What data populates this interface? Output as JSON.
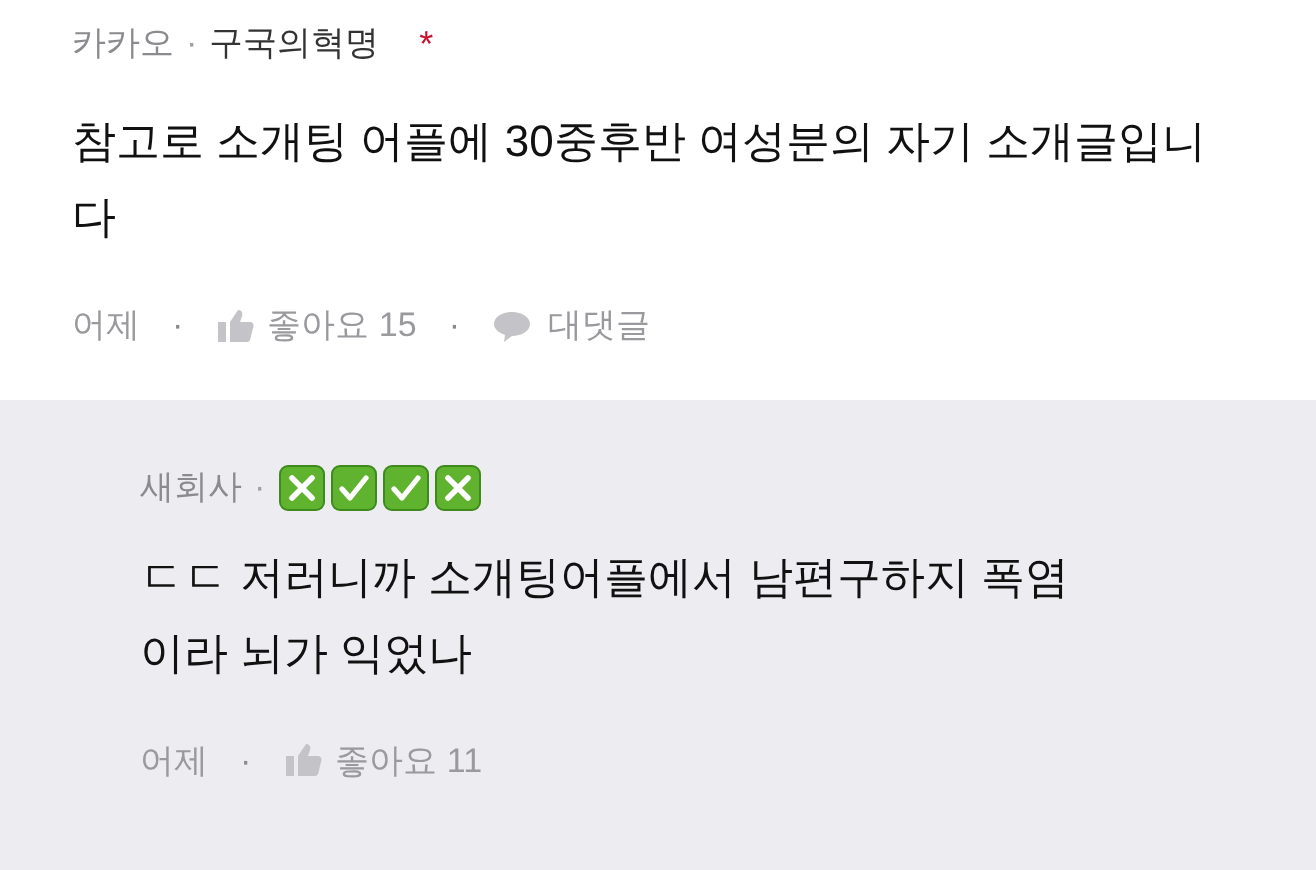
{
  "comments": [
    {
      "source": "카카오",
      "separator": "·",
      "author": "구국의혁명",
      "marker": "*",
      "body": "참고로 소개팅 어플에 30중후반 여성분의 자기 소개글입니다",
      "time": "어제",
      "action_separators": [
        "·",
        "·"
      ],
      "like_label": "좋아요 15",
      "reply_label": "대댓글",
      "is_reply": false
    },
    {
      "author": "새회사",
      "separator": "·",
      "badges": [
        {
          "kind": "cross"
        },
        {
          "kind": "check"
        },
        {
          "kind": "check"
        },
        {
          "kind": "cross"
        }
      ],
      "body": "ㄷㄷ 저러니까 소개팅어플에서 남편구하지 폭염이라 뇌가 익었나",
      "time": "어제",
      "action_separators": [
        "·"
      ],
      "like_label": "좋아요 11",
      "is_reply": true
    }
  ]
}
